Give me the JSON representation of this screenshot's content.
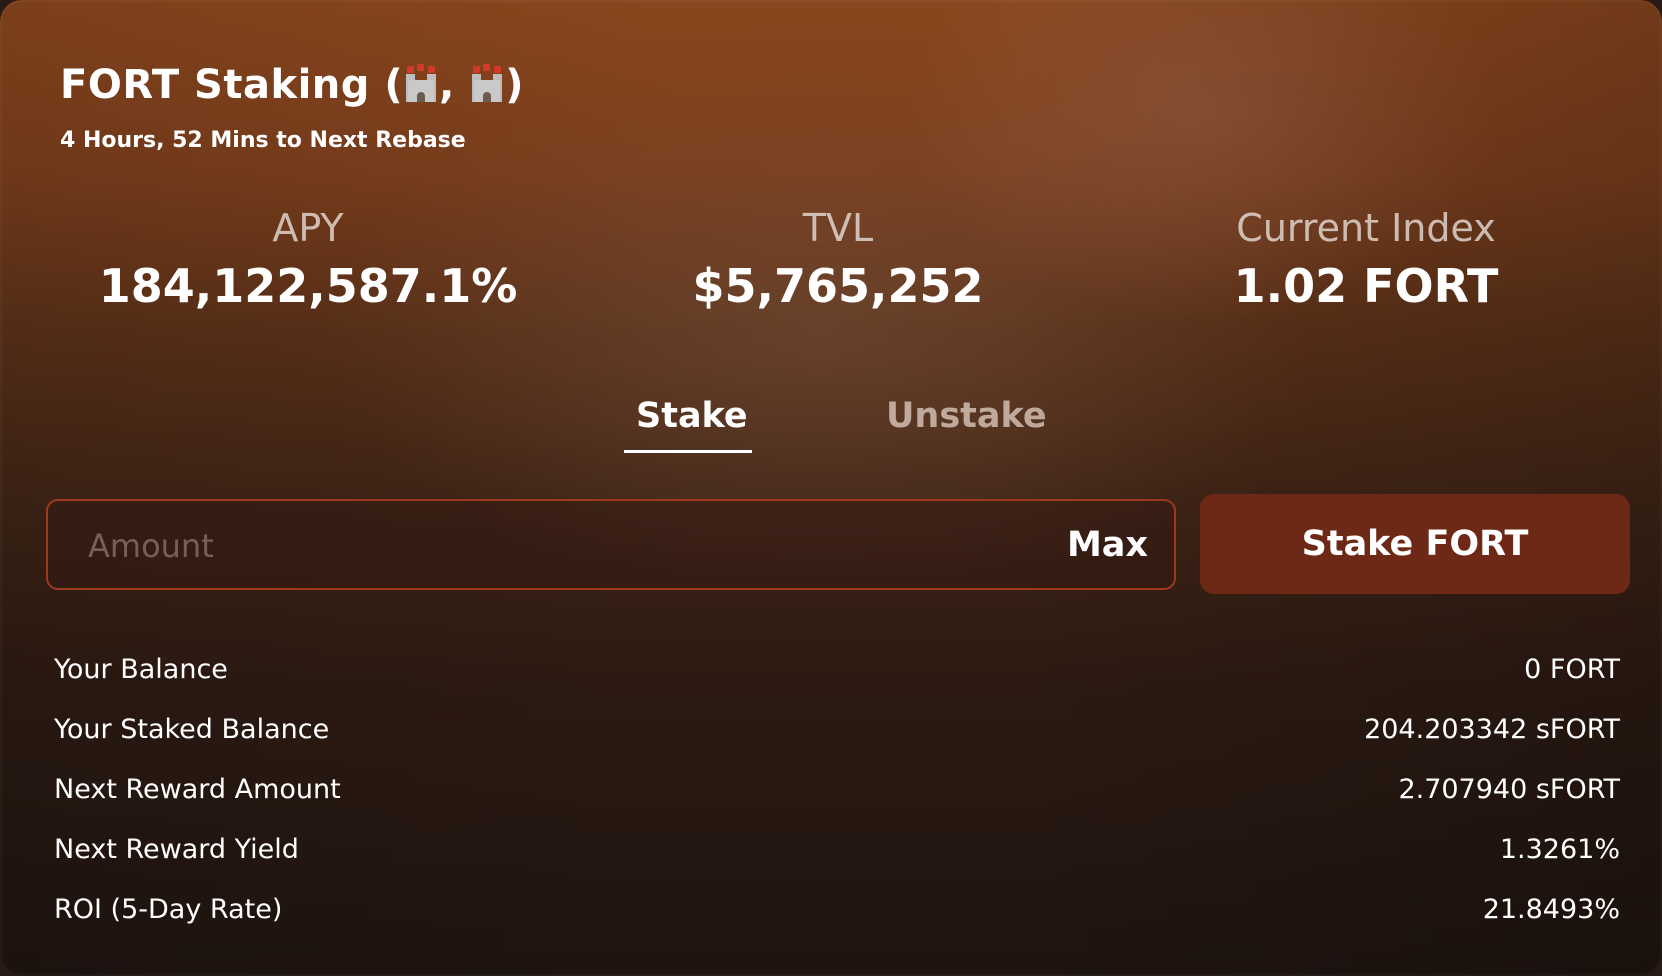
{
  "header": {
    "title_prefix": "FORT Staking (",
    "title_separator": ",",
    "title_suffix": ")",
    "title_icons": [
      "castle-icon",
      "castle-icon"
    ],
    "rebase_text": "4 Hours, 52 Mins to Next Rebase"
  },
  "stats": [
    {
      "label": "APY",
      "value": "184,122,587.1%"
    },
    {
      "label": "TVL",
      "value": "$5,765,252"
    },
    {
      "label": "Current Index",
      "value": "1.02 FORT"
    }
  ],
  "tabs": [
    {
      "label": "Stake",
      "active": true
    },
    {
      "label": "Unstake",
      "active": false
    }
  ],
  "amount": {
    "value": "",
    "placeholder": "Amount",
    "max_label": "Max"
  },
  "action_button": {
    "label": "Stake FORT"
  },
  "info": [
    {
      "label": "Your Balance",
      "value": "0 FORT"
    },
    {
      "label": "Your Staked Balance",
      "value": "204.203342 sFORT"
    },
    {
      "label": "Next Reward Amount",
      "value": "2.707940 sFORT"
    },
    {
      "label": "Next Reward Yield",
      "value": "1.3261%"
    },
    {
      "label": "ROI (5-Day Rate)",
      "value": "21.8493%"
    }
  ],
  "colors": {
    "accent_border": "#a0381e",
    "button_bg": "#6e2916",
    "text": "#ffffff"
  }
}
